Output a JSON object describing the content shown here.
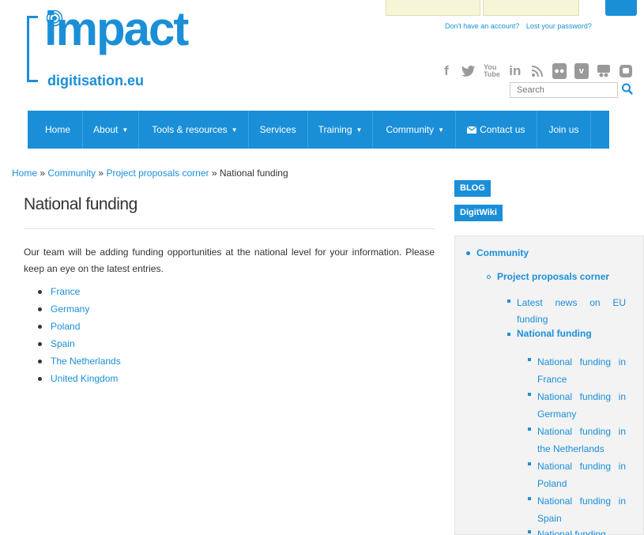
{
  "header": {
    "account_links": [
      "Don't have an account?",
      "Lost your password?"
    ],
    "logo": {
      "main": "impact",
      "sub": "digitisation.eu"
    },
    "social_icons": [
      "facebook-icon",
      "twitter-icon",
      "youtube-icon",
      "linkedin-icon",
      "rss-icon",
      "flickr-icon",
      "vimeo-icon",
      "slideshare-icon",
      "github-icon"
    ],
    "search_placeholder": "Search"
  },
  "nav": {
    "items": [
      {
        "label": "Home",
        "dropdown": false
      },
      {
        "label": "About",
        "dropdown": true
      },
      {
        "label": "Tools & resources",
        "dropdown": true
      },
      {
        "label": "Services",
        "dropdown": false
      },
      {
        "label": "Training",
        "dropdown": true
      },
      {
        "label": "Community",
        "dropdown": true
      },
      {
        "label": "Contact us",
        "dropdown": false
      },
      {
        "label": "Join us",
        "dropdown": false
      }
    ]
  },
  "breadcrumb": {
    "items": [
      "Home",
      "Community",
      "Project proposals corner",
      "National funding"
    ],
    "separator": "»"
  },
  "main": {
    "title": "National funding",
    "intro": "Our team will be adding funding opportunities at the national level for your information. Please keep an eye on the latest entries.",
    "countries": [
      "France",
      "Germany",
      "Poland",
      "Spain",
      "The Netherlands",
      "United Kingdom"
    ]
  },
  "sidebar": {
    "tags": [
      "BLOG",
      "DigitWiki"
    ],
    "tree": {
      "level1": "Community",
      "level2": "Project proposals corner",
      "level3": [
        "Latest news on EU funding",
        "National funding"
      ],
      "level4": [
        "National funding in France",
        "National funding in Germany",
        "National funding in the Netherlands",
        "National funding in Poland",
        "National funding in Spain",
        "National funding"
      ]
    }
  },
  "colors": {
    "brand": "#1a8fd8",
    "sidebar_bg": "#f3f3f3"
  }
}
